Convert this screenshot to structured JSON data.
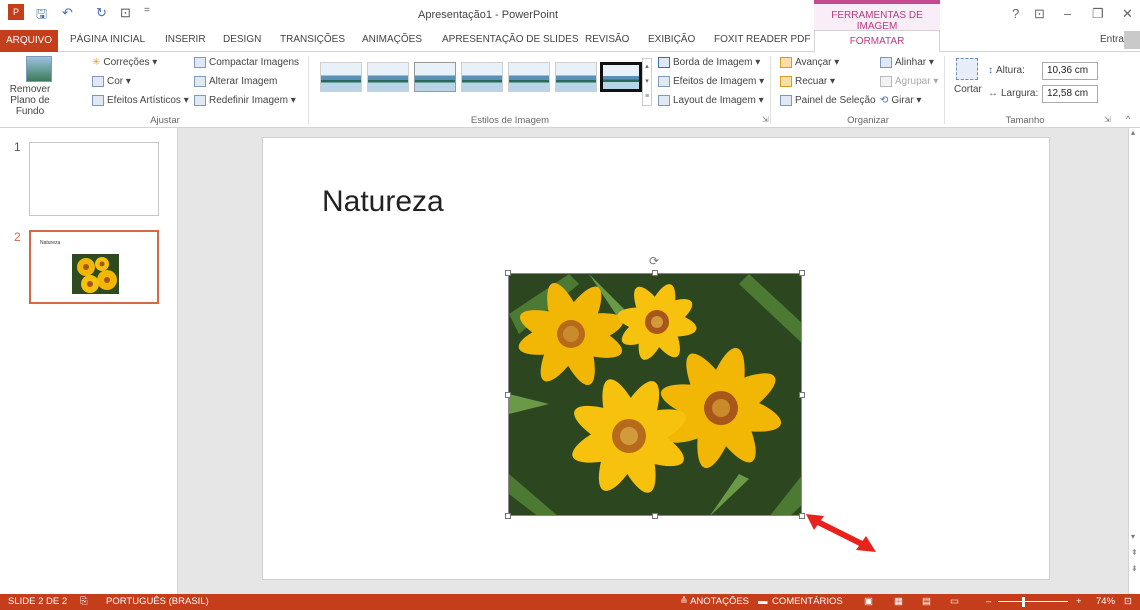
{
  "window": {
    "title": "Apresentação1 - PowerPoint",
    "context_tab_group": "FERRAMENTAS DE IMAGEM",
    "help": "?",
    "restore_ribbon": "⊡",
    "minimize": "–",
    "maximize": "❐",
    "close": "✕"
  },
  "tabs": {
    "file": "ARQUIVO",
    "items": [
      "PÁGINA INICIAL",
      "INSERIR",
      "DESIGN",
      "TRANSIÇÕES",
      "ANIMAÇÕES",
      "APRESENTAÇÃO DE SLIDES",
      "REVISÃO",
      "EXIBIÇÃO",
      "FOXIT READER PDF"
    ],
    "active": "FORMATAR",
    "signin": "Entrar"
  },
  "ribbon": {
    "ajustar": {
      "label": "Ajustar",
      "remove_bg": "Remover Plano de Fundo",
      "corrections": "Correções ▾",
      "color": "Cor ▾",
      "artistic": "Efeitos Artísticos ▾",
      "compress": "Compactar Imagens",
      "change": "Alterar Imagem",
      "reset": "Redefinir Imagem ▾"
    },
    "estilos": {
      "label": "Estilos de Imagem",
      "border": "Borda de Imagem ▾",
      "effects": "Efeitos de Imagem ▾",
      "layout": "Layout de Imagem ▾"
    },
    "organizar": {
      "label": "Organizar",
      "forward": "Avançar ▾",
      "backward": "Recuar ▾",
      "selection": "Painel de Seleção",
      "align": "Alinhar ▾",
      "group": "Agrupar ▾",
      "rotate": "Girar ▾"
    },
    "tamanho": {
      "label": "Tamanho",
      "crop": "Cortar",
      "height_label": "Altura:",
      "height_value": "10,36 cm",
      "width_label": "Largura:",
      "width_value": "12,58 cm"
    }
  },
  "slides": {
    "thumb1_num": "1",
    "thumb2_num": "2",
    "thumb2_title": "Natureza"
  },
  "slide": {
    "title": "Natureza"
  },
  "status": {
    "slide": "SLIDE 2 DE 2",
    "language": "PORTUGUÊS (BRASIL)",
    "notes": "≙ ANOTAÇÕES",
    "comments": "COMENTÁRIOS",
    "zoom": "74%"
  },
  "colors": {
    "accent": "#c43e1c",
    "context": "#b83b80",
    "arrow": "#e8231d"
  }
}
